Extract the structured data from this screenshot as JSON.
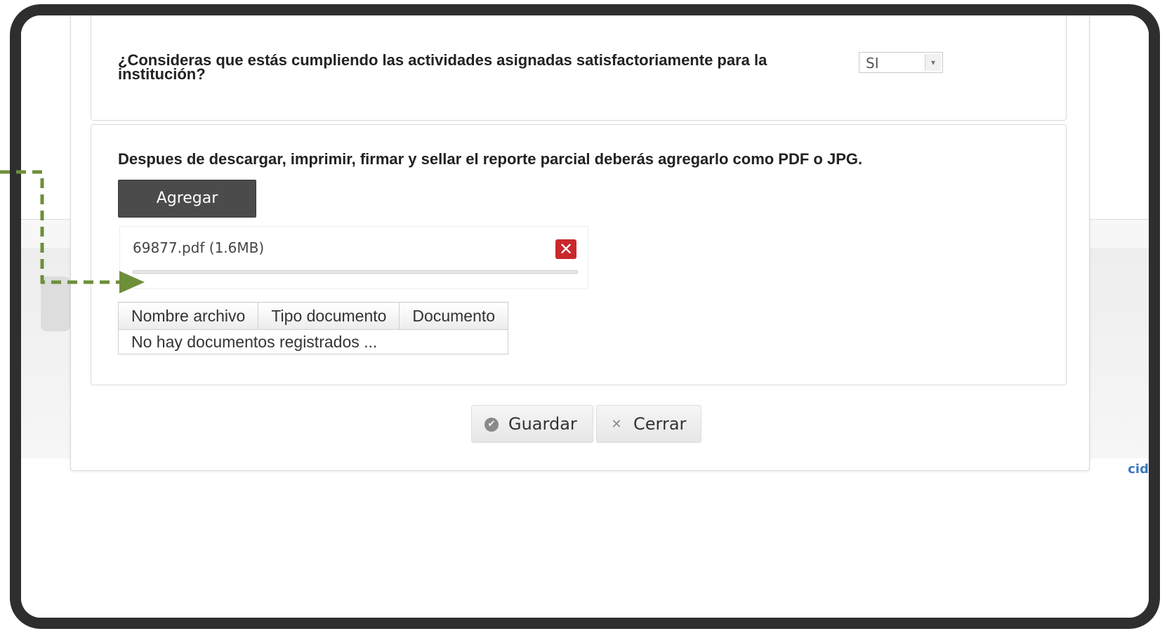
{
  "colors": {
    "frame": "#2e2e2e",
    "agregar_bg": "#4b4b4b",
    "remove_icon": "#c9282d",
    "annotation_arrow": "#6e8f3a",
    "link": "#3a77c2"
  },
  "question": {
    "text": "¿Consideras que estás cumpliendo las actividades asignadas satisfactoriamente para la institución?",
    "select_value": "SI",
    "select_icon": "chevron-down-icon"
  },
  "upload": {
    "instruction": "Despues de descargar, imprimir, firmar y sellar el reporte parcial deberás agregarlo como PDF o JPG.",
    "add_button_label": "Agregar",
    "file_name": "69877.pdf (1.6MB)",
    "remove_icon": "close-icon",
    "remove_glyph": "✕",
    "progress_percent": 100
  },
  "documents_table": {
    "columns": [
      "Nombre archivo",
      "Tipo documento",
      "Documento"
    ],
    "empty_message": "No hay documentos registrados ..."
  },
  "actions": {
    "save_label": "Guardar",
    "save_icon": "check-circle-icon",
    "save_glyph": "✔",
    "close_label": "Cerrar",
    "close_icon": "x-icon",
    "close_glyph": "✕"
  },
  "background": {
    "link_fragment": "cid"
  }
}
